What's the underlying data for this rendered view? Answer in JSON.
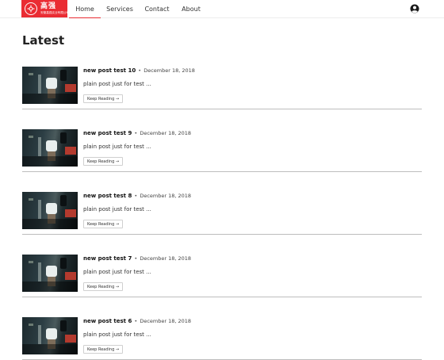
{
  "logo": {
    "title_cn": "高强",
    "subtitle_cn": "安徽高强实业有限公司"
  },
  "nav": {
    "items": [
      {
        "label": "Home",
        "active": true
      },
      {
        "label": "Services",
        "active": false
      },
      {
        "label": "Contact",
        "active": false
      },
      {
        "label": "About",
        "active": false
      }
    ]
  },
  "header": {
    "account_icon": "account-circle-icon"
  },
  "main": {
    "title": "Latest",
    "posts": [
      {
        "title": "new post test 10",
        "separator": "•",
        "date": "December 18, 2018",
        "excerpt": "plain post just for test ...",
        "button_label": "Keep Reading →"
      },
      {
        "title": "new post test 9",
        "separator": "•",
        "date": "December 18, 2018",
        "excerpt": "plain post just for test ...",
        "button_label": "Keep Reading →"
      },
      {
        "title": "new post test 8",
        "separator": "•",
        "date": "December 18, 2018",
        "excerpt": "plain post just for test ...",
        "button_label": "Keep Reading →"
      },
      {
        "title": "new post test 7",
        "separator": "•",
        "date": "December 18, 2018",
        "excerpt": "plain post just for test ...",
        "button_label": "Keep Reading →"
      },
      {
        "title": "new post test 6",
        "separator": "•",
        "date": "December 18, 2018",
        "excerpt": "plain post just for test ...",
        "button_label": "Keep Reading →"
      }
    ]
  },
  "colors": {
    "accent": "#ea2c33",
    "divider": "#bdbdbd"
  }
}
